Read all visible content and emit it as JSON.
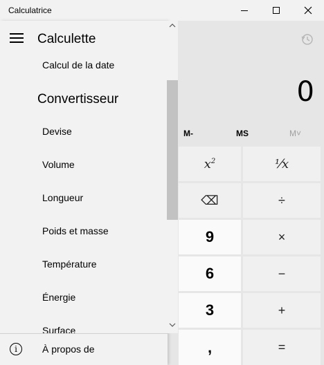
{
  "window": {
    "title": "Calculatrice"
  },
  "nav": {
    "header": "Calculette",
    "items_top": [
      {
        "label": "Calcul de la date"
      }
    ],
    "section_title": "Convertisseur",
    "converter_items": [
      {
        "label": "Devise"
      },
      {
        "label": "Volume"
      },
      {
        "label": "Longueur"
      },
      {
        "label": "Poids et masse"
      },
      {
        "label": "Température"
      },
      {
        "label": "Énergie"
      },
      {
        "label": "Surface"
      }
    ],
    "footer": {
      "about_label": "À propos de",
      "about_icon_glyph": "i"
    }
  },
  "display": {
    "value": "0"
  },
  "memory": {
    "mminus": "M-",
    "ms": "MS",
    "mview": "M˅"
  },
  "keys": {
    "square_label": "x",
    "square_sup": "2",
    "reciprocal_label": "⅟x",
    "backspace_label": "⌫",
    "divide_label": "÷",
    "nine_label": "9",
    "multiply_label": "×",
    "six_label": "6",
    "minus_label": "−",
    "three_label": "3",
    "plus_label": "+",
    "comma_label": ",",
    "equals_label": "="
  },
  "colors": {
    "nav_bg": "#f2f2f2",
    "calc_bg": "#e6e6e6",
    "op_key_bg": "#f0f0f0",
    "num_key_bg": "#fafafa",
    "disabled_text": "#a0a0a0"
  }
}
